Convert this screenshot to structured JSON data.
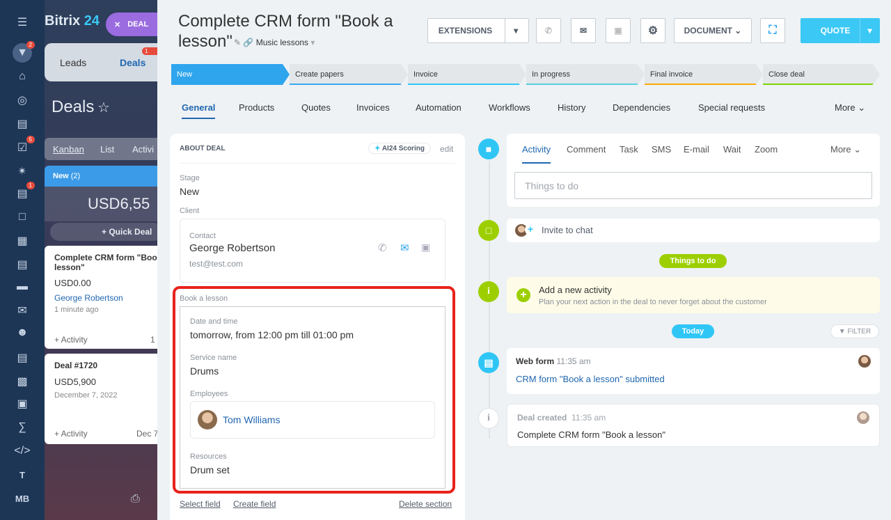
{
  "sidebar": {
    "badge_filter": "2",
    "badge_tasks": "5",
    "badge_chat": "1",
    "t_label": "T",
    "mb_label": "MB"
  },
  "background": {
    "brand_a": "Bitrix",
    "brand_b": "24",
    "deal_pill": "DEAL",
    "tabs": {
      "leads": "Leads",
      "deals": "Deals",
      "deals_badge": "1"
    },
    "heading": "Deals",
    "views": [
      "Kanban",
      "List",
      "Activi"
    ],
    "column": {
      "name": "New",
      "count": "(2)",
      "total": "USD6,55"
    },
    "quick_deal": "+ Quick Deal",
    "cards": [
      {
        "title": "Complete CRM form \"Boo lesson\"",
        "sum": "USD0.00",
        "contact": "George Robertson",
        "time": "1 minute ago",
        "activity": "+ Activity",
        "num": "1"
      },
      {
        "title": "Deal #1720",
        "sum": "USD5,900",
        "date": "December 7, 2022",
        "activity": "+ Activity",
        "num": "Dec 7"
      }
    ]
  },
  "header": {
    "title": "Complete CRM form \"Book a lesson\"",
    "category": "Music lessons",
    "extensions": "EXTENSIONS",
    "document": "DOCUMENT",
    "quote": "QUOTE"
  },
  "stages": [
    {
      "label": "New",
      "color": "#2fa5ee"
    },
    {
      "label": "Create papers",
      "color": "#39a8ef"
    },
    {
      "label": "Invoice",
      "color": "#2fc6f6"
    },
    {
      "label": "In progress",
      "color": "#55d0e0"
    },
    {
      "label": "Final invoice",
      "color": "#ffa900"
    },
    {
      "label": "Close deal",
      "color": "#7bd500"
    }
  ],
  "tabs": [
    "General",
    "Products",
    "Quotes",
    "Invoices",
    "Automation",
    "Workflows",
    "History",
    "Dependencies",
    "Special requests",
    "More"
  ],
  "about": {
    "heading": "ABOUT DEAL",
    "scoring": "AI24 Scoring",
    "edit": "edit",
    "stage_label": "Stage",
    "stage_value": "New",
    "client_label": "Client",
    "contact_label": "Contact",
    "contact_name": "George Robertson",
    "contact_email": "test@test.com"
  },
  "book": {
    "section_title": "Book a lesson",
    "datetime_label": "Date and time",
    "datetime_value": "tomorrow, from 12:00 pm till 01:00 pm",
    "service_label": "Service name",
    "service_value": "Drums",
    "employees_label": "Employees",
    "employee_name": "Tom Williams",
    "resources_label": "Resources",
    "resources_value": "Drum set"
  },
  "footer_links": {
    "select": "Select field",
    "create": "Create field",
    "delete": "Delete section"
  },
  "activity": {
    "tabs": [
      "Activity",
      "Comment",
      "Task",
      "SMS",
      "E-mail",
      "Wait",
      "Zoom",
      "More"
    ],
    "placeholder": "Things to do",
    "invite": "Invite to chat",
    "todo_pill": "Things to do",
    "new_title": "Add a new activity",
    "new_desc": "Plan your next action in the deal to never forget about the customer",
    "today": "Today",
    "filter": "FILTER",
    "webform_title": "Web form",
    "webform_time": "11:35 am",
    "webform_link": "CRM form \"Book a lesson\" submitted",
    "created_title": "Deal created",
    "created_time": "11:35 am",
    "created_text": "Complete CRM form \"Book a lesson\""
  }
}
